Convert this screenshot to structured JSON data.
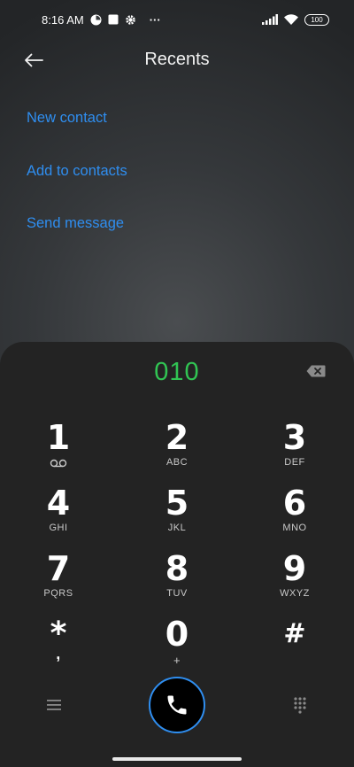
{
  "status_bar": {
    "time": "8:16 AM",
    "more_indicator": "···",
    "battery": "100",
    "icons": [
      "data-saver-icon",
      "gallery-icon",
      "settings-icon",
      "signal-icon",
      "wifi-icon",
      "battery-icon"
    ]
  },
  "header": {
    "title": "Recents"
  },
  "actions": [
    {
      "label": "New contact"
    },
    {
      "label": "Add to contacts"
    },
    {
      "label": "Send message"
    }
  ],
  "colors": {
    "accent_blue": "#2f8ef0",
    "number_green": "#31c453",
    "dialer_bg": "#232323"
  },
  "dialer": {
    "number": "010",
    "keys": [
      {
        "digit": "1",
        "letters": "",
        "icon": "voicemail-icon"
      },
      {
        "digit": "2",
        "letters": "ABC"
      },
      {
        "digit": "3",
        "letters": "DEF"
      },
      {
        "digit": "4",
        "letters": "GHI"
      },
      {
        "digit": "5",
        "letters": "JKL"
      },
      {
        "digit": "6",
        "letters": "MNO"
      },
      {
        "digit": "7",
        "letters": "PQRS"
      },
      {
        "digit": "8",
        "letters": "TUV"
      },
      {
        "digit": "9",
        "letters": "WXYZ"
      },
      {
        "digit": "*",
        "letters": ","
      },
      {
        "digit": "0",
        "letters": "+"
      },
      {
        "digit": "#",
        "letters": ""
      }
    ]
  }
}
